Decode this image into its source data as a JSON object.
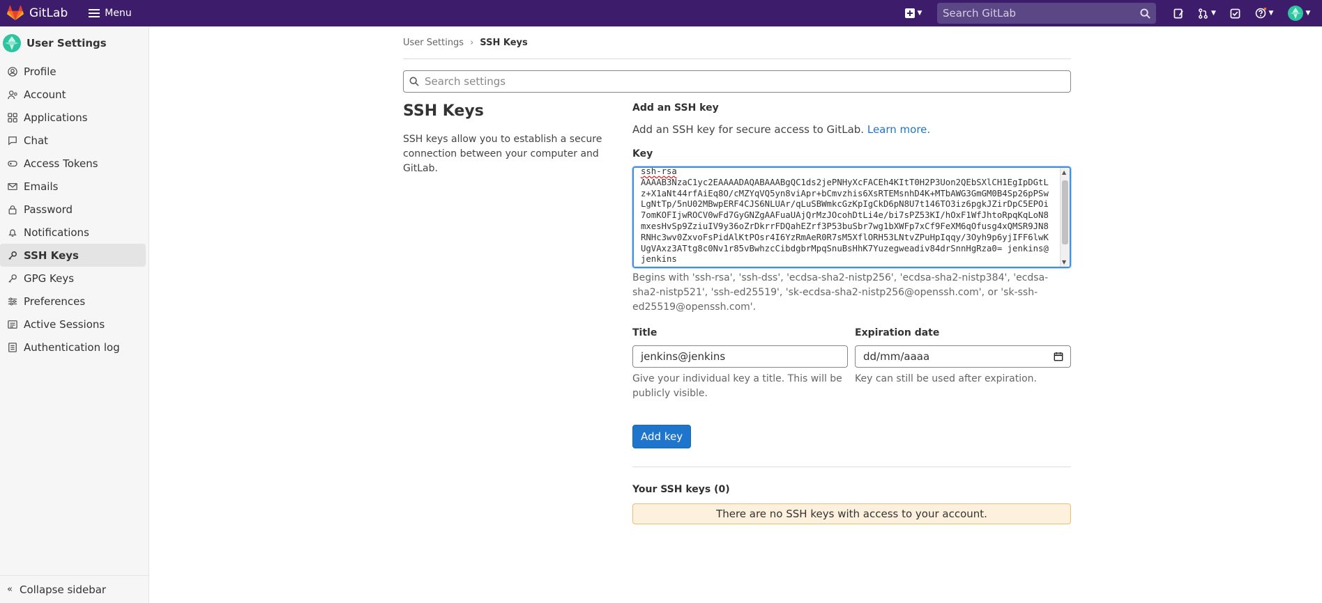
{
  "app": {
    "name": "GitLab",
    "menu_label": "Menu",
    "search_placeholder": "Search GitLab",
    "brand_color": "#3d1d6b"
  },
  "sidebar": {
    "title": "User Settings",
    "items": [
      {
        "label": "Profile",
        "icon": "profile-icon"
      },
      {
        "label": "Account",
        "icon": "account-icon"
      },
      {
        "label": "Applications",
        "icon": "applications-icon"
      },
      {
        "label": "Chat",
        "icon": "chat-icon"
      },
      {
        "label": "Access Tokens",
        "icon": "token-icon"
      },
      {
        "label": "Emails",
        "icon": "mail-icon"
      },
      {
        "label": "Password",
        "icon": "lock-icon"
      },
      {
        "label": "Notifications",
        "icon": "bell-icon"
      },
      {
        "label": "SSH Keys",
        "icon": "key-icon",
        "active": true
      },
      {
        "label": "GPG Keys",
        "icon": "key-icon"
      },
      {
        "label": "Preferences",
        "icon": "preferences-icon"
      },
      {
        "label": "Active Sessions",
        "icon": "sessions-icon"
      },
      {
        "label": "Authentication log",
        "icon": "log-icon"
      }
    ],
    "collapse_label": "Collapse sidebar"
  },
  "breadcrumb": {
    "parent": "User Settings",
    "current": "SSH Keys"
  },
  "settings_search": {
    "placeholder": "Search settings"
  },
  "left": {
    "heading": "SSH Keys",
    "description": "SSH keys allow you to establish a secure connection between your computer and GitLab."
  },
  "form": {
    "section_heading": "Add an SSH key",
    "intro_text": "Add an SSH key for secure access to GitLab.",
    "learn_more": "Learn more.",
    "key_label": "Key",
    "key_value_head": "ssh-rsa",
    "key_value_body": "AAAAB3NzaC1yc2EAAAADAQABAAABgQC1ds2jePNHyXcFACEh4KItT0H2P3Uon2QEbSXlCH1EgIpDGtLz+X1aNt44rfAiEq8O/cMZYqVQ5yn8viApr+bCmvzhis6XsRTEMsnhD4K+MTbAWG3GmGM0B4Sp26pPSwLgNtTp/5nU02MBwpERF4CJS6NLUAr/qLuSBWmkcGzKpIgCkD6pN8U7t146TO3iz6pgkJZirDpC5EPOi7omKOFIjwROCV0wFd7GyGNZgAAFuaUAjQrMzJOcohDtLi4e/bi7sPZ53KI/hOxF1WfJhtoRpqKqLoN8mxesHvSp9ZziuIV9y36oZrDkrrFDQahEZrf3P53buSbr7wg1bXWFp7xCf9FeXM6qOfusg4xQMSR9JN8RNHc3wv0ZxvoFsPidAlKtPOsr4I6YzRmAeR0R7sM5XflORH53LNtvZPuHpIqqy/3Oyh9p6yjIFF6lwKUgVAxz3ATtg8c0Nv1r85vBwhzcCibdgbrMpqSnuBsHhK7Yuzegweadiv84drSnnHgRza0= jenkins@jenkins",
    "key_help": "Begins with 'ssh-rsa', 'ssh-dss', 'ecdsa-sha2-nistp256', 'ecdsa-sha2-nistp384', 'ecdsa-sha2-nistp521', 'ssh-ed25519', 'sk-ecdsa-sha2-nistp256@openssh.com', or 'sk-ssh-ed25519@openssh.com'.",
    "title_label": "Title",
    "title_value": "jenkins@jenkins",
    "title_help": "Give your individual key a title. This will be publicly visible.",
    "expiration_label": "Expiration date",
    "expiration_placeholder": "dd/mm/aaaa",
    "expiration_help": "Key can still be used after expiration.",
    "submit_label": "Add key"
  },
  "keys_list": {
    "heading": "Your SSH keys (0)",
    "empty_message": "There are no SSH keys with access to your account."
  },
  "colors": {
    "accent": "#1f75cb",
    "alert_bg": "#fdf1dd",
    "alert_border": "#e9be74"
  }
}
